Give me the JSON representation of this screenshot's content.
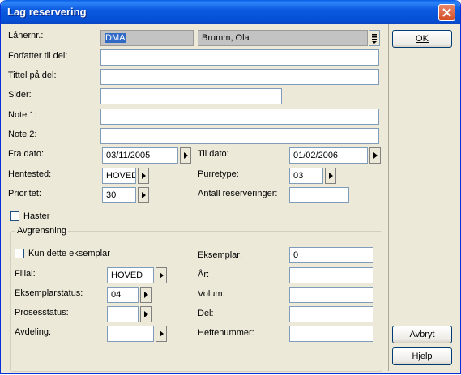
{
  "window": {
    "title": "Lag reservering"
  },
  "labels": {
    "lanernr": "Lånernr.:",
    "forfatter": "Forfatter til del:",
    "tittel": "Tittel på del:",
    "sider": "Sider:",
    "note1": "Note 1:",
    "note2": "Note 2:",
    "fra_dato": "Fra dato:",
    "til_dato": "Til dato:",
    "hentested": "Hentested:",
    "purretype": "Purretype:",
    "prioritet": "Prioritet:",
    "antall": "Antall reserveringer:",
    "haster": "Haster",
    "avgrensning": "Avgrensning",
    "kun_dette": "Kun dette eksemplar",
    "filial": "Filial:",
    "eksemplarstatus": "Eksemplarstatus:",
    "prosessstatus": "Prosesstatus:",
    "avdeling": "Avdeling:",
    "eksemplar": "Eksemplar:",
    "ar": "År:",
    "volum": "Volum:",
    "del": "Del:",
    "heftenummer": "Heftenummer:"
  },
  "values": {
    "lanernr": "DMA",
    "laner_name": "Brumm, Ola",
    "forfatter": "",
    "tittel": "",
    "sider": "",
    "note1": "",
    "note2": "",
    "fra_dato": "03/11/2005",
    "til_dato": "01/02/2006",
    "hentested": "HOVED",
    "purretype": "03",
    "prioritet": "30",
    "antall": "",
    "filial": "HOVED",
    "eksemplarstatus": "04",
    "prosessstatus": "",
    "avdeling": "",
    "eksemplar": "0",
    "ar": "",
    "volum": "",
    "del": "",
    "heftenummer": ""
  },
  "checkboxes": {
    "haster": false,
    "kun_dette": false
  },
  "buttons": {
    "ok": "OK",
    "avbryt": "Avbryt",
    "hjelp": "Hjelp"
  },
  "colors": {
    "titlebar": "#0a5ee6",
    "dialog_bg": "#ece9d8",
    "selection": "#316ac5"
  }
}
